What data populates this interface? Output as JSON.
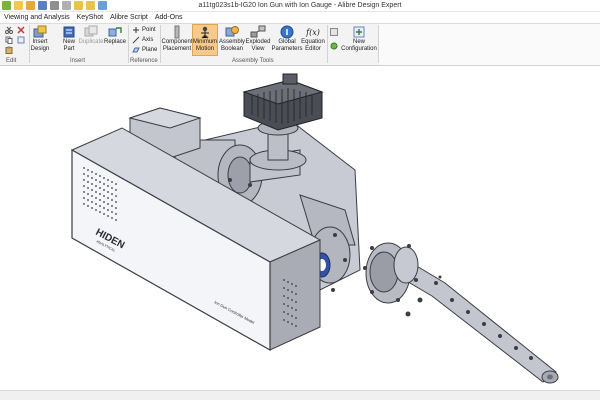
{
  "window": {
    "title": "a11tg023s1b-IG20 Ion Gun with Ion Gauge - Alibre Design Expert"
  },
  "menu": {
    "tabs": [
      "Viewing and Analysis",
      "KeyShot",
      "Alibre Script",
      "Add-Ons"
    ]
  },
  "ribbon": {
    "groups": {
      "edit": "Edit",
      "insert": "Insert",
      "reference": "Reference",
      "assembly_tools": "Assembly Tools"
    },
    "insert_design": "Insert\nDesign",
    "new_part": "New\nPart",
    "duplicate": "Duplicate",
    "replace": "Replace",
    "point": "Point",
    "axis": "Axis",
    "plane": "Plane",
    "component_placement": "Component\nPlacement",
    "minimum_motion": "Minimum\nMotion",
    "assembly_boolean": "Assembly\nBoolean",
    "exploded_view": "Exploded\nView",
    "global_parameters": "Global\nParameters",
    "equation_editor": "Equation\nEditor",
    "new_configuration": "New\nConfiguration",
    "equation_symbol": "f(x)"
  },
  "model": {
    "brand": "HIDEN",
    "brand_sub": "ANALYTICAL",
    "label": "Ion Gun Controller Model"
  },
  "colors": {
    "active_tool": "#f7c98a",
    "model_body": "#c9ccd6",
    "model_dark": "#3a3d44"
  }
}
